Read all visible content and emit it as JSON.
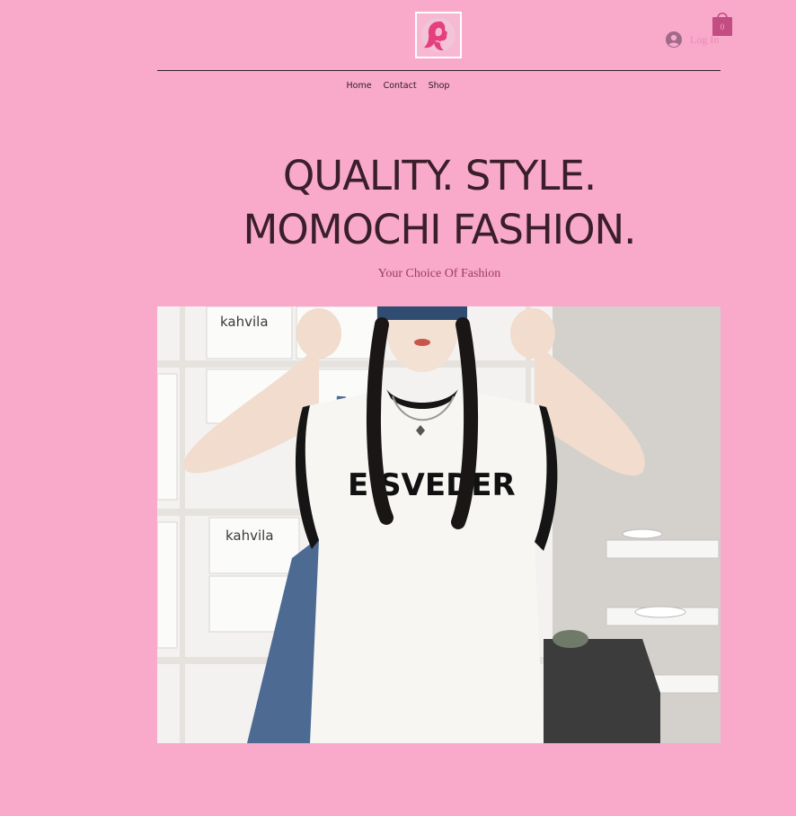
{
  "header": {
    "logo_icon": "woman-silhouette-logo-icon",
    "login": {
      "label": "Log In",
      "icon": "user-avatar-icon"
    },
    "cart": {
      "count": "0",
      "icon": "shopping-bag-icon"
    }
  },
  "nav": {
    "items": [
      {
        "label": "Home"
      },
      {
        "label": "Contact"
      },
      {
        "label": "Shop"
      }
    ]
  },
  "hero": {
    "headline_line1": "QUALITY. STYLE.",
    "headline_line2": "MOMOCHI FASHION.",
    "tagline": "Your Choice Of Fashion",
    "image": {
      "shelf_box_text": "kahvila",
      "shirt_text": "E SVEDER"
    }
  },
  "colors": {
    "background": "#f9a9ca",
    "headline": "#3a1f2a",
    "accent": "#e4407e",
    "login_text": "#e98bb6"
  }
}
